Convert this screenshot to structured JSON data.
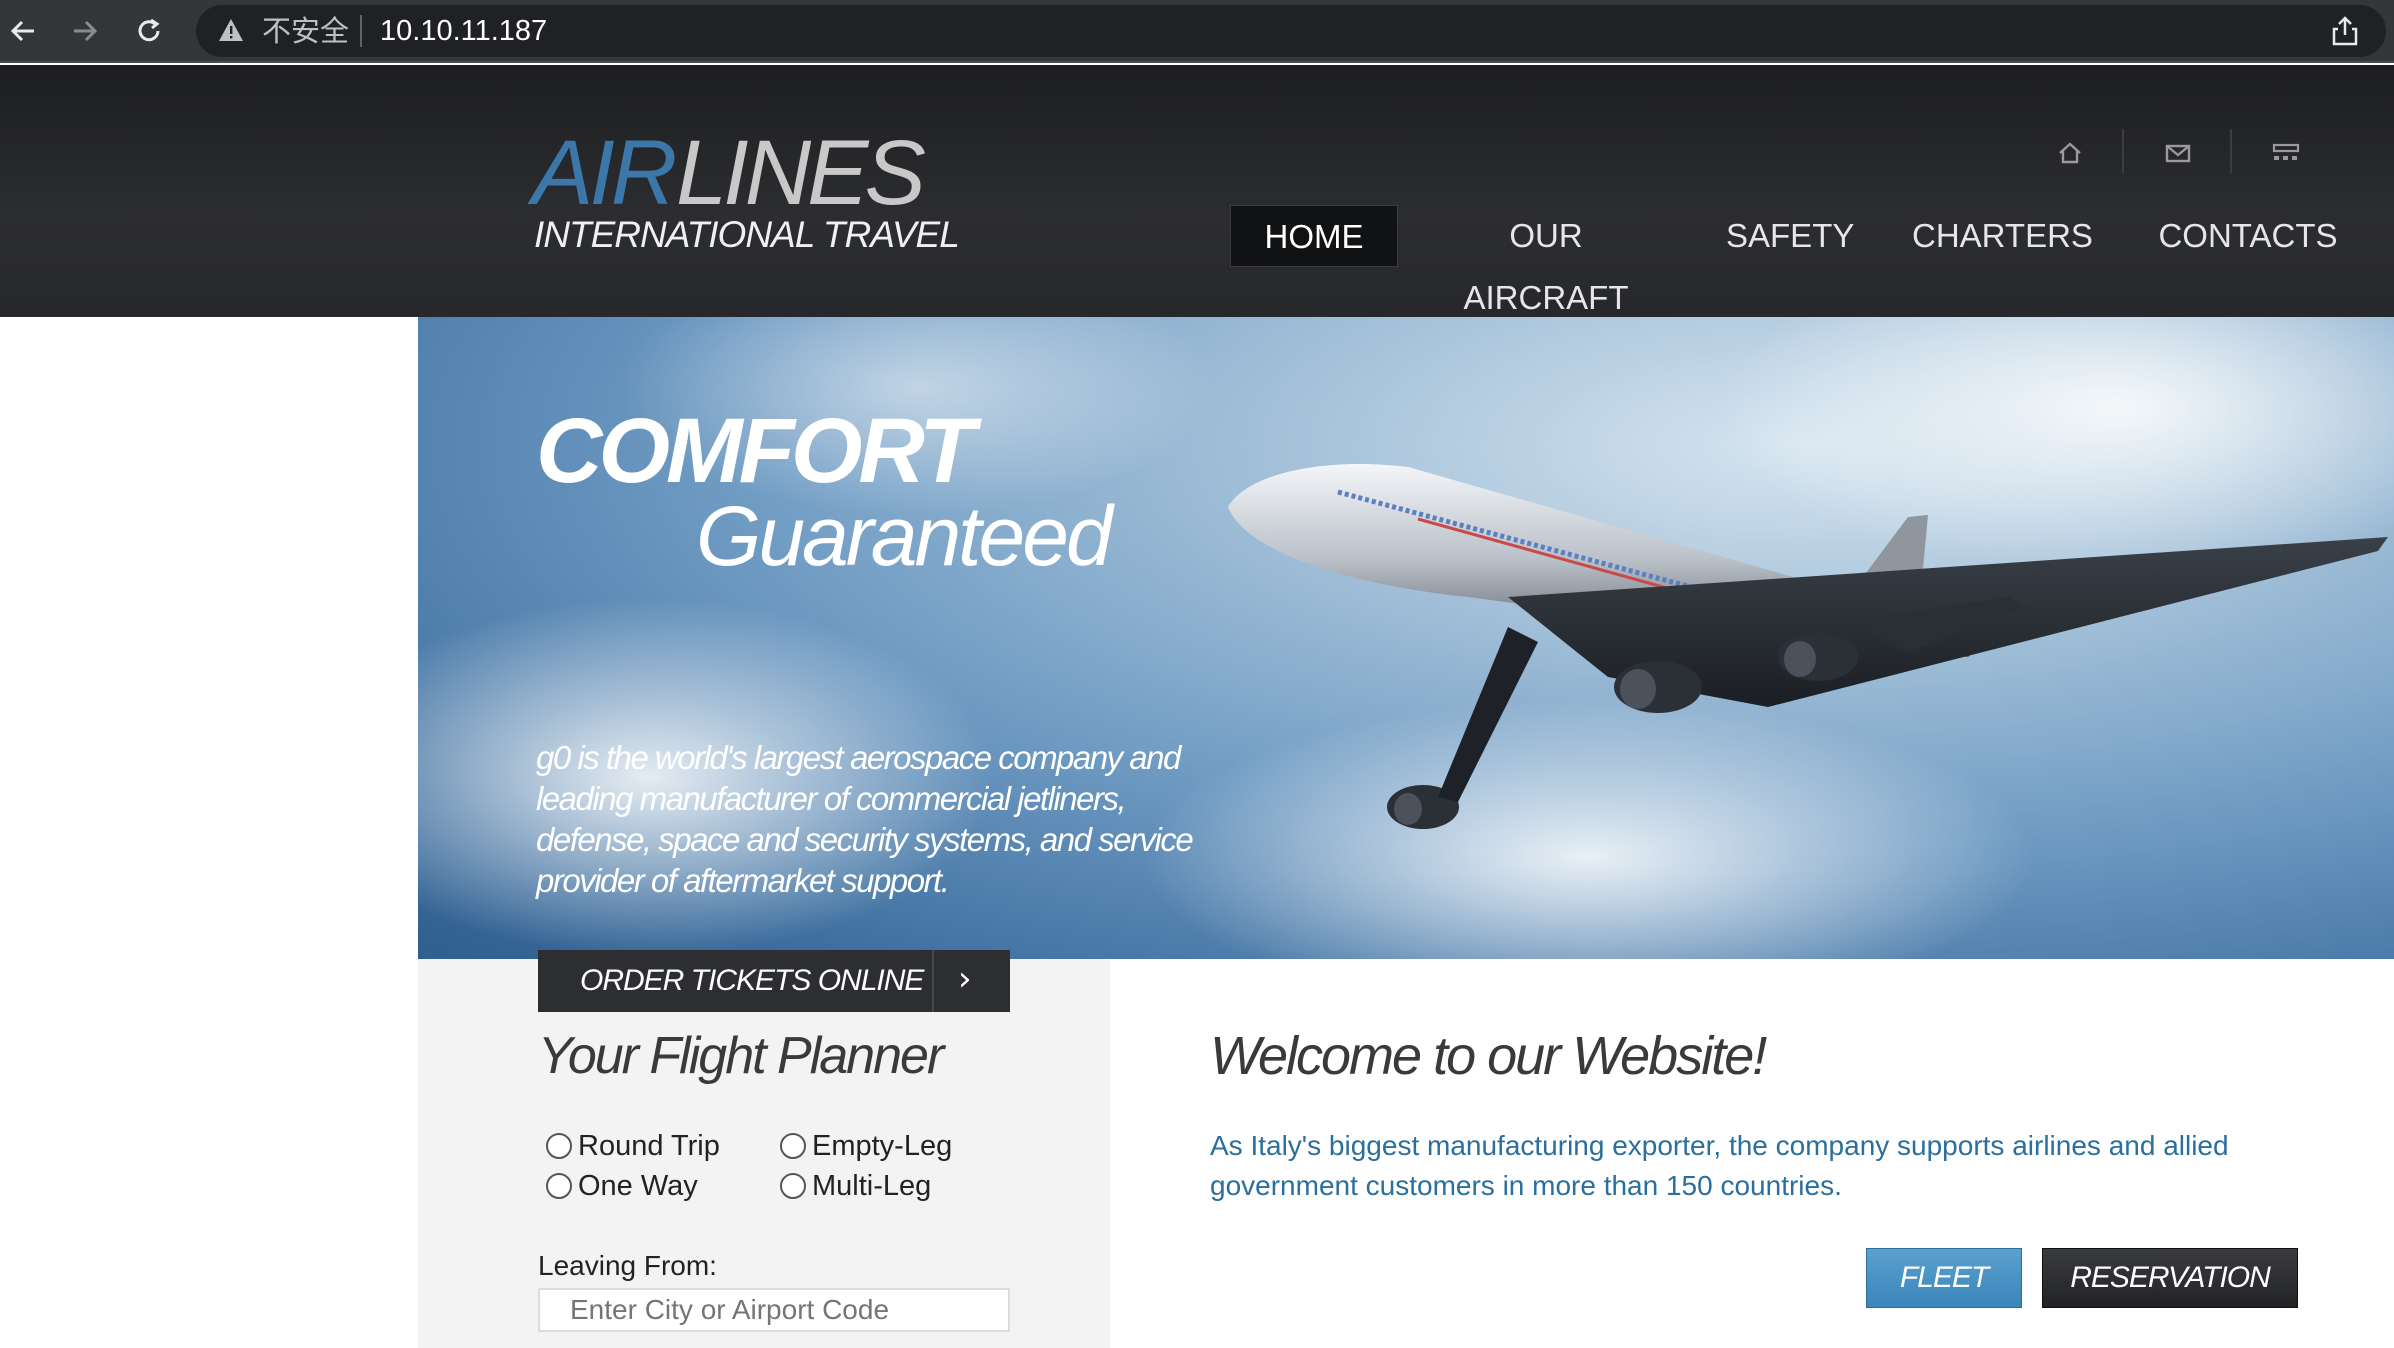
{
  "browser": {
    "back_icon": "arrow-left-icon",
    "forward_icon": "arrow-right-icon",
    "reload_icon": "reload-icon",
    "security_label": "不安全",
    "url": "10.10.11.187",
    "share_icon": "share-icon"
  },
  "header": {
    "logo_air": "AIR",
    "logo_lines": "LINES",
    "logo_subtitle": "INTERNATIONAL TRAVEL",
    "icons": [
      "home-icon",
      "mail-icon",
      "sitemap-icon"
    ],
    "menu": [
      {
        "label": "HOME",
        "active": true
      },
      {
        "label": "OUR AIRCRAFT",
        "active": false
      },
      {
        "label": "SAFETY",
        "active": false
      },
      {
        "label": "CHARTERS",
        "active": false
      },
      {
        "label": "CONTACTS",
        "active": false
      }
    ]
  },
  "hero": {
    "title_line1": "COMFORT",
    "title_line2": "Guaranteed",
    "description": "g0 is the world's largest aerospace company and leading manufacturer of commercial jetliners, defense, space and security systems, and service provider of aftermarket support."
  },
  "planner": {
    "order_button": "ORDER TICKETS ONLINE",
    "order_arrow": "›",
    "title": "Your Flight Planner",
    "trip_types": [
      "Round Trip",
      "Empty-Leg",
      "One Way",
      "Multi-Leg"
    ],
    "leaving_label": "Leaving From:",
    "leaving_placeholder": "Enter City or Airport Code"
  },
  "welcome": {
    "title": "Welcome to our Website!",
    "text": "As Italy's biggest manufacturing exporter, the company supports airlines and allied government customers in more than 150 countries.",
    "fleet_button": "FLEET",
    "reservation_button": "RESERVATION"
  },
  "colors": {
    "accent_blue": "#3b77a8",
    "text_blue": "#2a6f9e",
    "header_dark": "#2c2d30"
  }
}
